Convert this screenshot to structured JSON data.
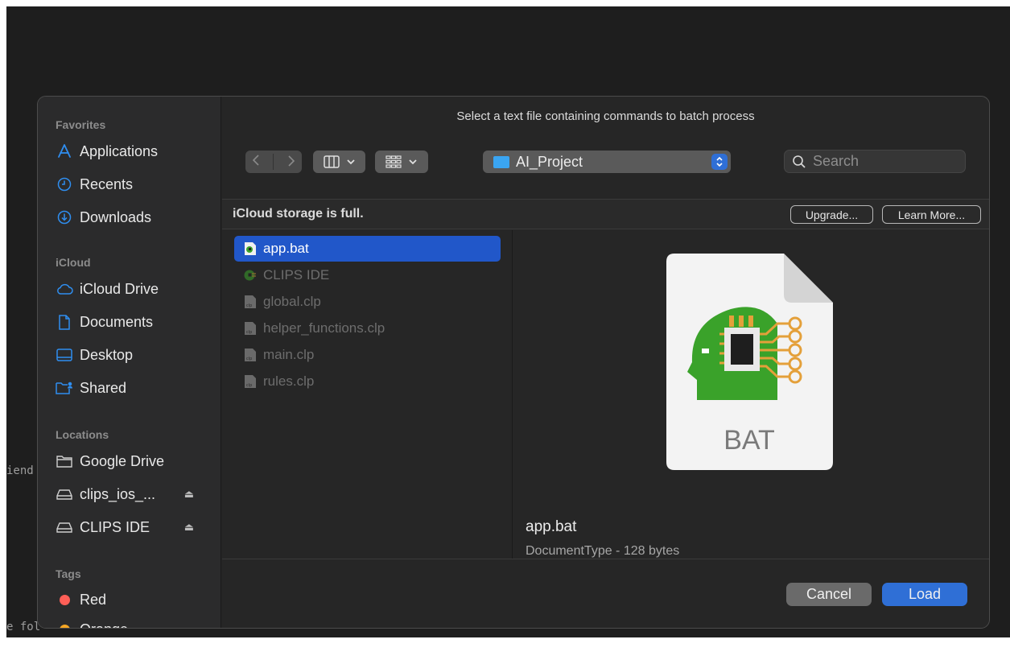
{
  "dialog": {
    "title": "Select a text file containing commands to batch process"
  },
  "background": {
    "fragment_1": "iend",
    "fragment_2": "e fol"
  },
  "sidebar": {
    "favorites_header": "Favorites",
    "favorites": [
      {
        "label": "Applications",
        "icon": "applications-icon"
      },
      {
        "label": "Recents",
        "icon": "clock-icon"
      },
      {
        "label": "Downloads",
        "icon": "download-icon"
      }
    ],
    "icloud_header": "iCloud",
    "icloud": [
      {
        "label": "iCloud Drive",
        "icon": "cloud-icon"
      },
      {
        "label": "Documents",
        "icon": "document-icon"
      },
      {
        "label": "Desktop",
        "icon": "desktop-icon"
      },
      {
        "label": "Shared",
        "icon": "shared-folder-icon"
      }
    ],
    "locations_header": "Locations",
    "locations": [
      {
        "label": "Google Drive",
        "icon": "folder-icon"
      },
      {
        "label": "clips_ios_...",
        "icon": "drive-icon"
      },
      {
        "label": "CLIPS IDE",
        "icon": "drive-icon"
      }
    ],
    "tags_header": "Tags",
    "tags": [
      {
        "label": "Red",
        "color": "#ff5f57"
      },
      {
        "label": "Orange",
        "color": "#f5a623"
      }
    ]
  },
  "toolbar": {
    "path_label": "AI_Project",
    "search_placeholder": "Search"
  },
  "banner": {
    "message": "iCloud storage is full.",
    "upgrade_label": "Upgrade...",
    "learn_more_label": "Learn More..."
  },
  "files": [
    {
      "name": "app.bat",
      "selected": true
    },
    {
      "name": "CLIPS IDE",
      "selected": false
    },
    {
      "name": "global.clp",
      "selected": false
    },
    {
      "name": "helper_functions.clp",
      "selected": false
    },
    {
      "name": "main.clp",
      "selected": false
    },
    {
      "name": "rules.clp",
      "selected": false
    }
  ],
  "preview": {
    "badge": "BAT",
    "name": "app.bat",
    "meta": "DocumentType - 128 bytes"
  },
  "buttons": {
    "cancel": "Cancel",
    "load": "Load"
  },
  "colors": {
    "accent": "#2f6fd6",
    "selection": "#2157c9",
    "head_green": "#3aa22a",
    "circuit_orange": "#e4a03a"
  }
}
